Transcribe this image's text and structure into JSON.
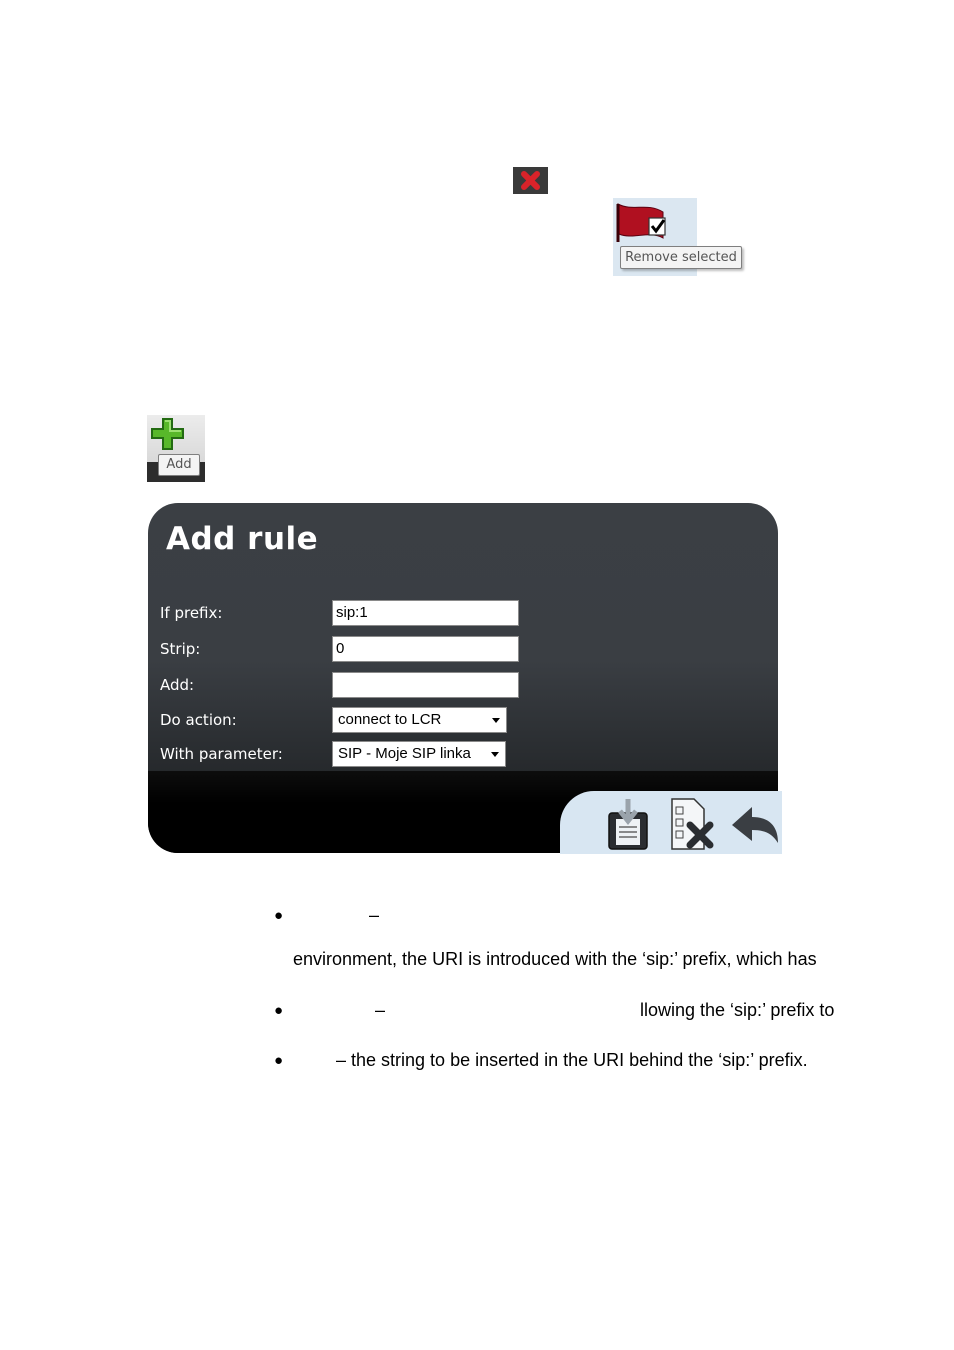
{
  "icons": {
    "delete": "delete-x-icon",
    "remove_selected": "remove-selected-flag-icon",
    "add": "add-plus-icon",
    "save": "save-icon",
    "cancel": "cancel-icon",
    "back": "back-arrow-icon"
  },
  "remove_tooltip": "Remove selected",
  "add_tooltip": "Add",
  "dialog": {
    "title": "Add rule",
    "fields": {
      "if_prefix": {
        "label": "If prefix:",
        "value": "sip:1"
      },
      "strip": {
        "label": "Strip:",
        "value": "0"
      },
      "add": {
        "label": "Add:",
        "value": ""
      },
      "do_action": {
        "label": "Do action:",
        "value": "connect to LCR"
      },
      "with_parameter": {
        "label": "With parameter:",
        "value": "SIP - Moje SIP linka"
      }
    }
  },
  "text": {
    "b1_dash": "–",
    "b1_cont": "environment, the URI is introduced with the ‘sip:’ prefix, which has",
    "b2_dash": "–",
    "b2_right": "llowing the ‘sip:’ prefix to",
    "b3": "– the string to be inserted in the URI behind the ‘sip:’ prefix."
  },
  "colors": {
    "dialog_bg": "#3b3f44",
    "toolbar_bg": "#d8e6f2",
    "add_green": "#58b82a",
    "delete_red": "#d9232a"
  }
}
